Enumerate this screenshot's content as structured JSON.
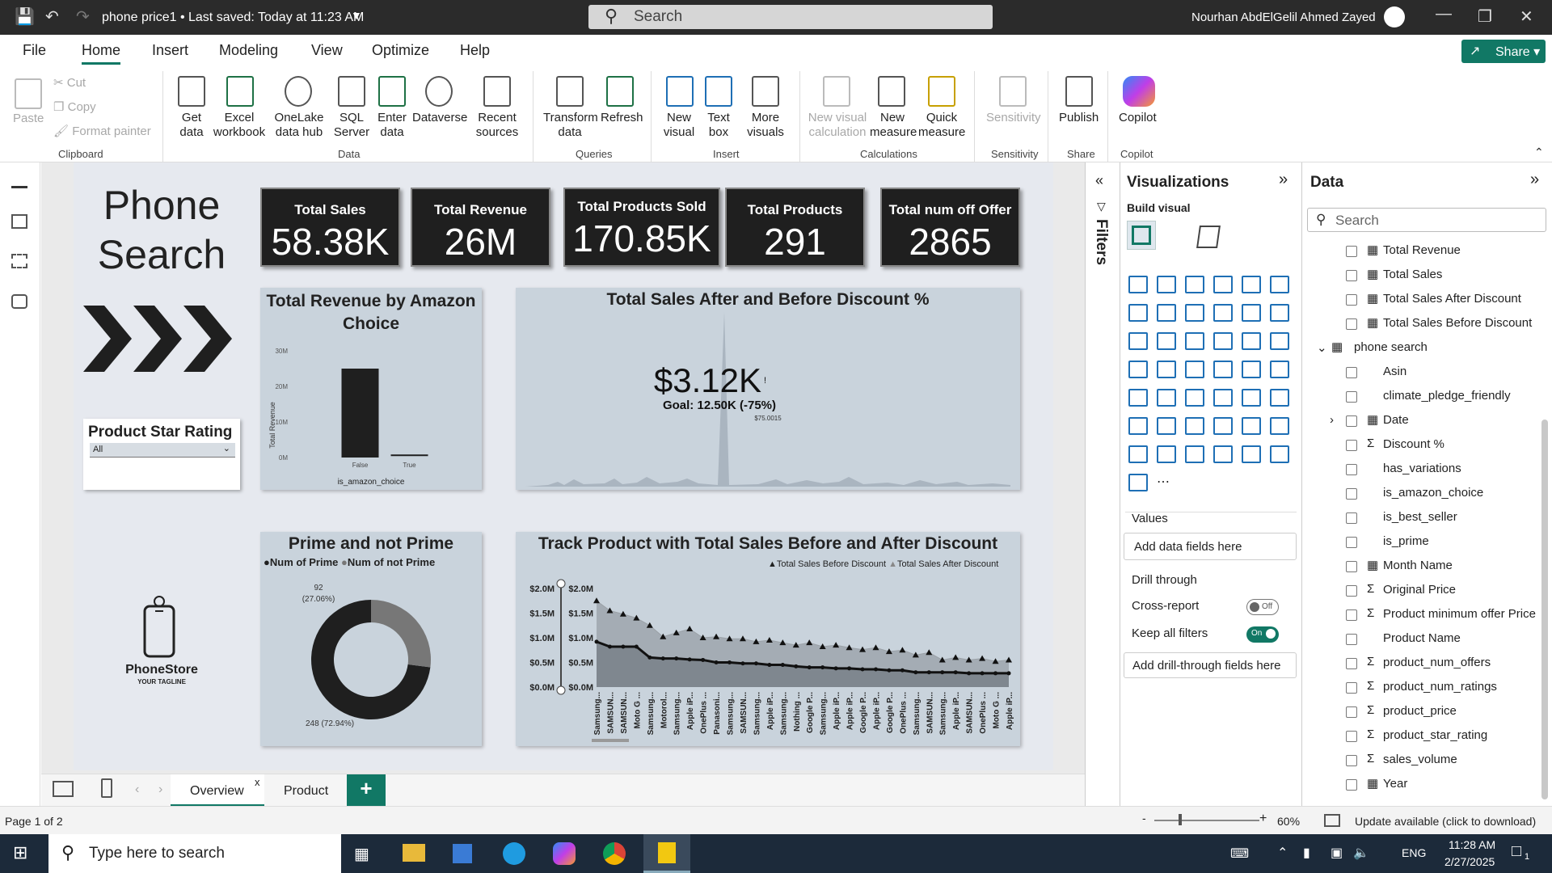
{
  "titlebar": {
    "doc_title": "phone price1 • Last saved: Today at 11:23 AM",
    "search_placeholder": "Search",
    "user": "Nourhan AbdElGelil Ahmed Zayed"
  },
  "menu": {
    "file": "File",
    "home": "Home",
    "insert": "Insert",
    "modeling": "Modeling",
    "view": "View",
    "optimize": "Optimize",
    "help": "Help",
    "share": "Share"
  },
  "ribbon": {
    "clipboard": {
      "paste": "Paste",
      "cut": "Cut",
      "copy": "Copy",
      "format_painter": "Format painter",
      "group": "Clipboard"
    },
    "data": {
      "get_data": "Get data",
      "excel": "Excel workbook",
      "onelake": "OneLake data hub",
      "sql": "SQL Server",
      "enter": "Enter data",
      "dataverse": "Dataverse",
      "recent": "Recent sources",
      "group": "Data"
    },
    "queries": {
      "transform": "Transform data",
      "refresh": "Refresh",
      "group": "Queries"
    },
    "insert": {
      "new_visual": "New visual",
      "text_box": "Text box",
      "more_visuals": "More visuals",
      "group": "Insert"
    },
    "calculations": {
      "new_visual_calc": "New visual calculation",
      "new_measure": "New measure",
      "quick_measure": "Quick measure",
      "group": "Calculations"
    },
    "sensitivity": {
      "label": "Sensitivity",
      "group": "Sensitivity"
    },
    "share": {
      "publish": "Publish",
      "group": "Share"
    },
    "copilot": {
      "label": "Copilot",
      "group": "Copilot"
    }
  },
  "report": {
    "heading": "Phone Search",
    "cards": [
      {
        "title": "Total Sales",
        "value": "58.38K"
      },
      {
        "title": "Total Revenue",
        "value": "26M"
      },
      {
        "title": "Total Products Sold",
        "value": "170.85K"
      },
      {
        "title": "Total Products",
        "value": "291"
      },
      {
        "title": "Total num off Offer",
        "value": "2865"
      }
    ],
    "slicer": {
      "title": "Product Star Rating",
      "value": "All"
    },
    "logo": {
      "name": "PhoneStore",
      "tagline": "YOUR TAGLINE"
    },
    "kpi": {
      "title": "Total Sales After and Before Discount %",
      "value": "$3.12K",
      "mark": "!",
      "goal": "Goal: 12.50K (-75%)",
      "peak_label": "$75.0015"
    }
  },
  "chart_data": [
    {
      "type": "bar",
      "title": "Total Revenue by Amazon Choice",
      "xlabel": "is_amazon_choice",
      "ylabel": "Total Revenue",
      "categories": [
        "False",
        "True"
      ],
      "values": [
        25000000,
        400000
      ],
      "yticks": [
        "0M",
        "10M",
        "20M",
        "30M"
      ],
      "ylim": [
        0,
        30000000
      ]
    },
    {
      "type": "pie",
      "title": "Prime and not Prime",
      "legend": [
        "Num of Prime",
        "Num of not Prime"
      ],
      "values": [
        248,
        92
      ],
      "labels": [
        "248 (72.94%)",
        "92 (27.06%)"
      ],
      "colors": [
        "#1f1f1f",
        "#777777"
      ]
    },
    {
      "type": "area",
      "title": "Track Product with Total Sales Before and After Discount",
      "legend": [
        "Total Sales Before Discount",
        "Total Sales After Discount"
      ],
      "yticks": [
        "$0.0M",
        "$0.5M",
        "$1.0M",
        "$1.5M",
        "$2.0M"
      ],
      "ylim": [
        0,
        2.0
      ],
      "categories": [
        "Samsung...",
        "SAMSUN...",
        "SAMSUN...",
        "Moto G ...",
        "Samsung...",
        "Motorol...",
        "Samsung...",
        "Apple iP...",
        "OnePlus ...",
        "Panasoni...",
        "Samsung...",
        "SAMSUN...",
        "Samsung...",
        "Apple iP...",
        "Samsung...",
        "Nothing ...",
        "Google P...",
        "Samsung...",
        "Apple iP...",
        "Apple iP...",
        "Google P...",
        "Apple iP...",
        "Google P...",
        "OnePlus ...",
        "Samsung...",
        "SAMSUN...",
        "Samsung...",
        "Apple iP...",
        "SAMSUN...",
        "OnePlus ...",
        "Moto G ...",
        "Apple iP..."
      ],
      "series": [
        {
          "name": "Total Sales Before Discount",
          "values": [
            1.75,
            1.55,
            1.48,
            1.4,
            1.25,
            1.02,
            1.1,
            1.18,
            1.0,
            1.02,
            0.98,
            0.98,
            0.92,
            0.95,
            0.9,
            0.85,
            0.9,
            0.82,
            0.85,
            0.8,
            0.76,
            0.8,
            0.72,
            0.75,
            0.65,
            0.7,
            0.55,
            0.6,
            0.55,
            0.58,
            0.52,
            0.55
          ]
        },
        {
          "name": "Total Sales After Discount",
          "values": [
            0.92,
            0.82,
            0.82,
            0.82,
            0.6,
            0.58,
            0.58,
            0.56,
            0.55,
            0.5,
            0.5,
            0.48,
            0.48,
            0.45,
            0.45,
            0.42,
            0.4,
            0.4,
            0.38,
            0.38,
            0.36,
            0.36,
            0.34,
            0.34,
            0.3,
            0.3,
            0.3,
            0.3,
            0.28,
            0.28,
            0.28,
            0.28
          ]
        }
      ]
    }
  ],
  "filters_label": "Filters",
  "viz": {
    "title": "Visualizations",
    "build": "Build visual",
    "values": "Values",
    "add_fields": "Add data fields here",
    "drill": "Drill through",
    "cross": "Cross-report",
    "cross_state": "Off",
    "keep": "Keep all filters",
    "keep_state": "On",
    "add_drill": "Add drill-through fields here"
  },
  "data_pane": {
    "title": "Data",
    "search": "Search",
    "fields": [
      "Total Revenue",
      "Total Sales",
      "Total Sales After Discount",
      "Total Sales Before Discount",
      "phone search",
      "Asin",
      "climate_pledge_friendly",
      "Date",
      "Discount %",
      "has_variations",
      "is_amazon_choice",
      "is_best_seller",
      "is_prime",
      "Month Name",
      "Original Price",
      "Product minimum offer Price",
      "Product Name",
      "product_num_offers",
      "product_num_ratings",
      "product_price",
      "product_star_rating",
      "sales_volume",
      "Year"
    ]
  },
  "tabs": {
    "overview": "Overview",
    "close": "x",
    "product": "Product",
    "add": "+"
  },
  "status": {
    "page": "Page 1 of 2",
    "zoom": "60%",
    "update": "Update available (click to download)"
  },
  "taskbar": {
    "search": "Type here to search",
    "lang": "ENG",
    "time": "11:28 AM",
    "date": "2/27/2025",
    "notif": "1"
  }
}
